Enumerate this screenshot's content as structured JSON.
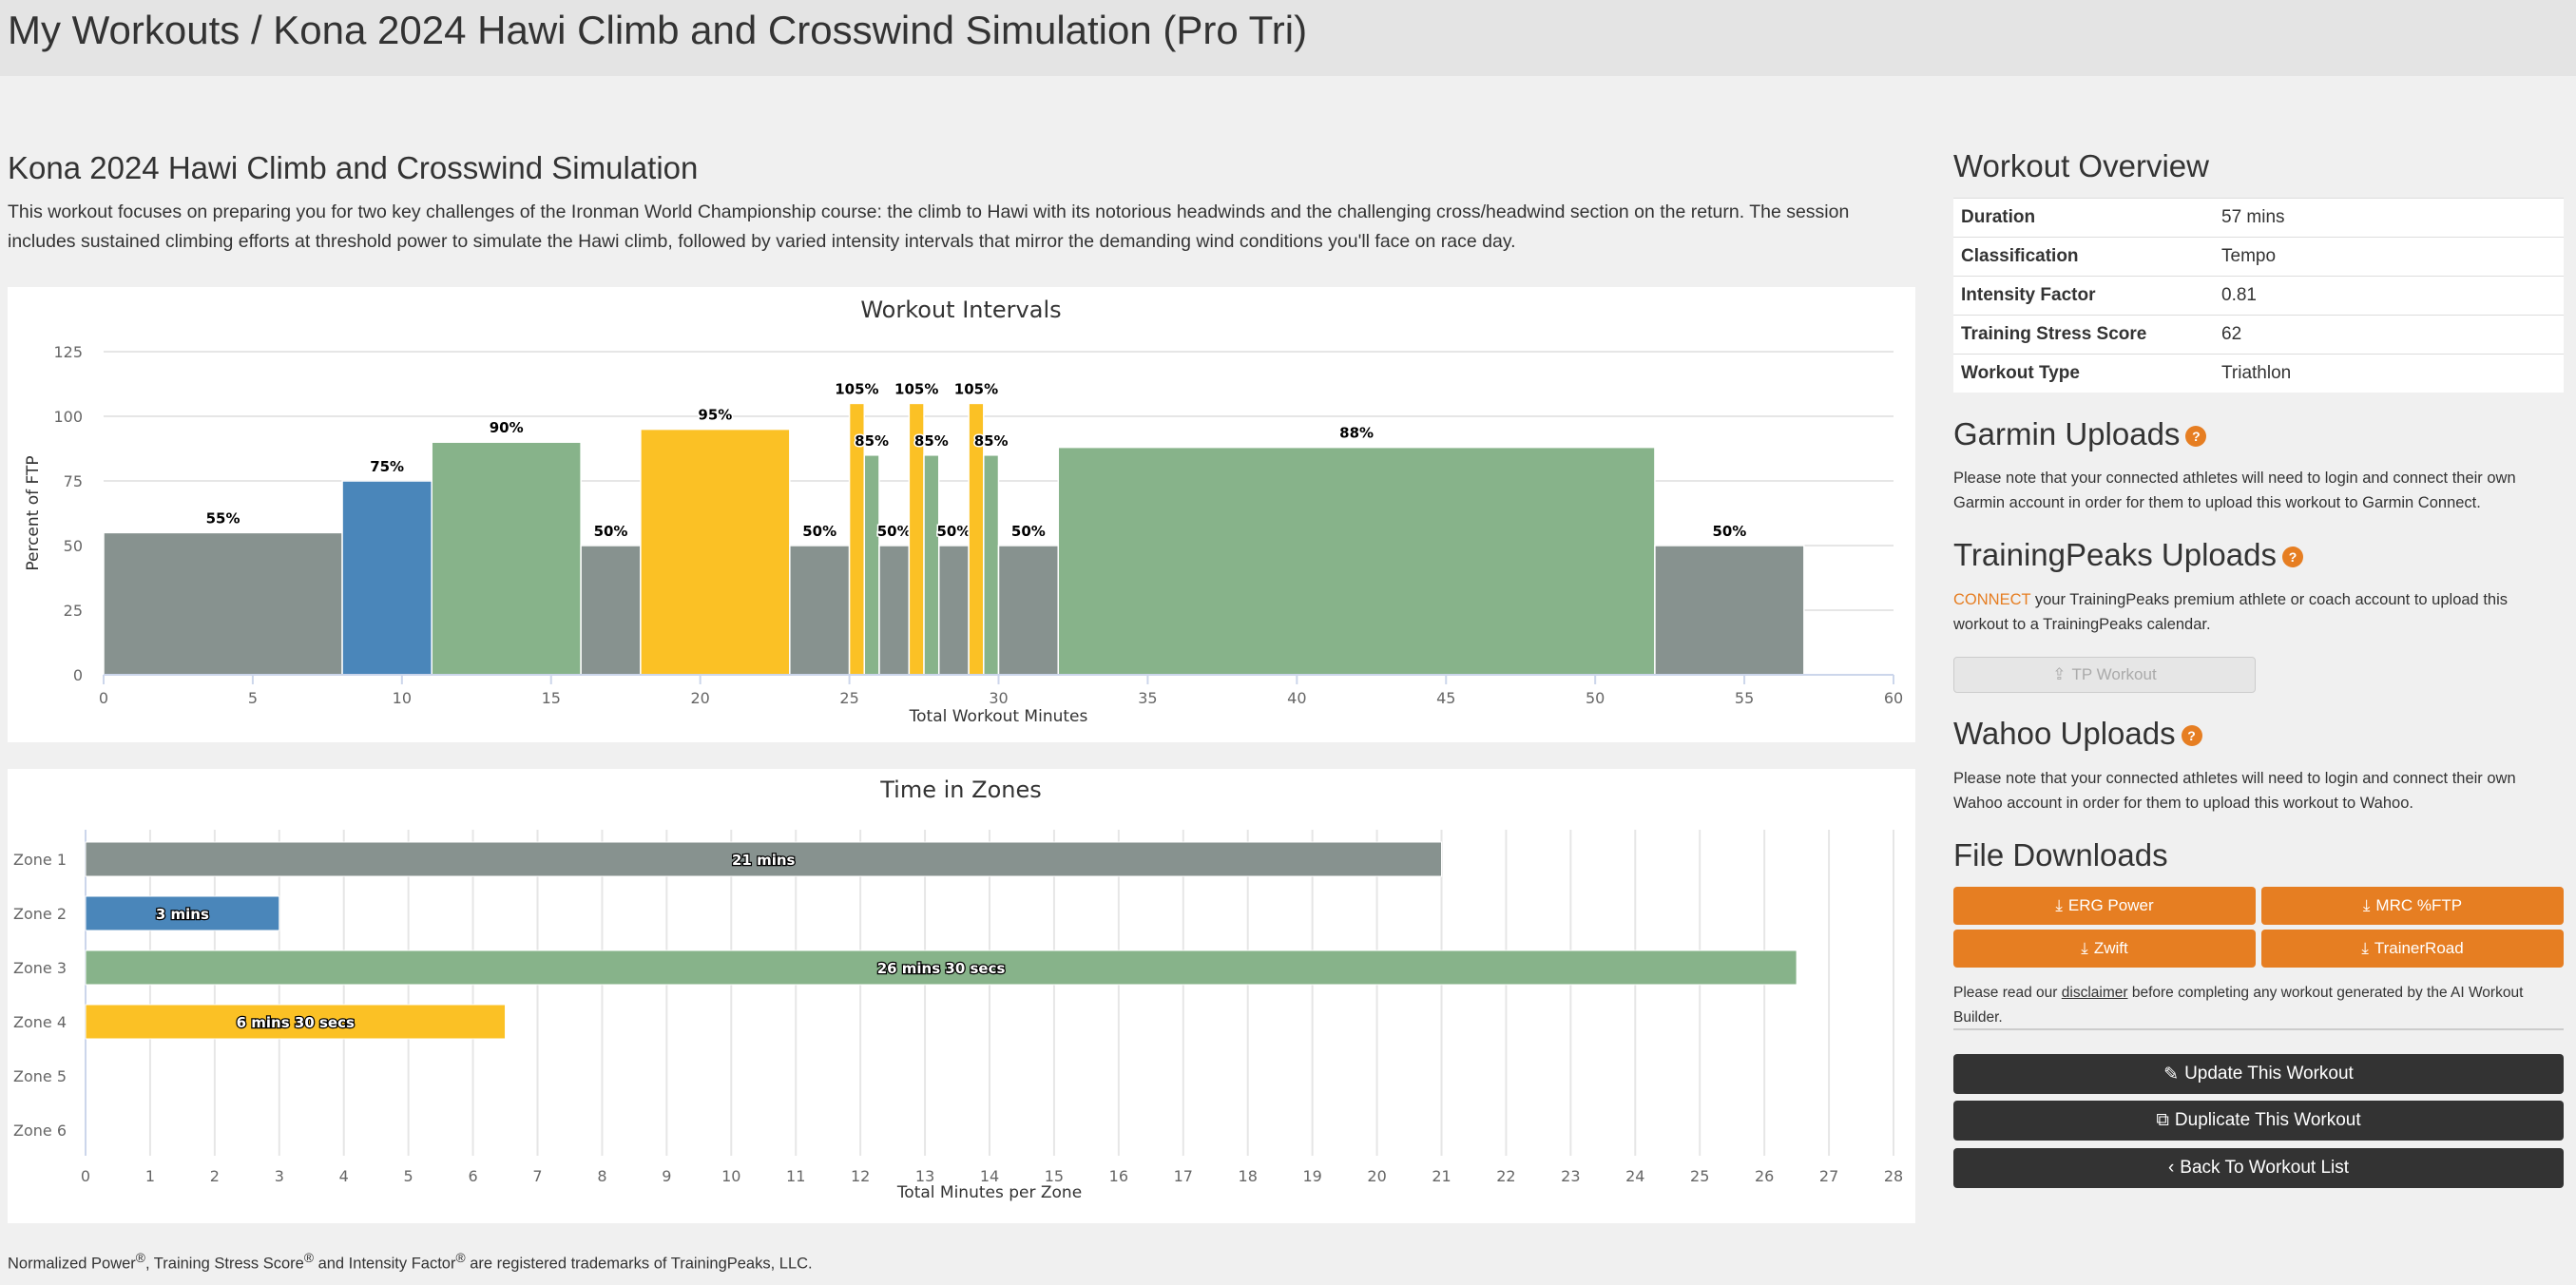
{
  "header": {
    "title": "My Workouts / Kona 2024 Hawi Climb and Crosswind Simulation (Pro Tri)"
  },
  "workout": {
    "title": "Kona 2024 Hawi Climb and Crosswind Simulation",
    "description": "This workout focuses on preparing you for two key challenges of the Ironman World Championship course: the climb to Hawi with its notorious headwinds and the challenging cross/headwind section on the return. The session includes sustained climbing efforts at threshold power to simulate the Hawi climb, followed by varied intensity intervals that mirror the demanding wind conditions you'll face on race day."
  },
  "colors": {
    "zone1": "#87928f",
    "zone2": "#4a86ba",
    "zone3": "#87b38a",
    "zone4": "#fbc125",
    "accent": "#e67e22",
    "dark": "#333333"
  },
  "chart_data": [
    {
      "type": "bar",
      "title": "Workout Intervals",
      "xlabel": "Total Workout Minutes",
      "ylabel": "Percent of FTP",
      "xlim": [
        0,
        60
      ],
      "ylim": [
        0,
        125
      ],
      "xticks": [
        0,
        5,
        10,
        15,
        20,
        25,
        30,
        35,
        40,
        45,
        50,
        55,
        60
      ],
      "yticks": [
        0,
        25,
        50,
        75,
        100,
        125
      ],
      "grid": true,
      "intervals": [
        {
          "start": 0,
          "end": 8,
          "value": 55,
          "label": "55%",
          "zone": 1
        },
        {
          "start": 8,
          "end": 11,
          "value": 75,
          "label": "75%",
          "zone": 2
        },
        {
          "start": 11,
          "end": 16,
          "value": 90,
          "label": "90%",
          "zone": 3
        },
        {
          "start": 16,
          "end": 18,
          "value": 50,
          "label": "50%",
          "zone": 1
        },
        {
          "start": 18,
          "end": 23,
          "value": 95,
          "label": "95%",
          "zone": 4
        },
        {
          "start": 23,
          "end": 25,
          "value": 50,
          "label": "50%",
          "zone": 1
        },
        {
          "start": 25,
          "end": 25.5,
          "value": 105,
          "label": "105%",
          "zone": 4
        },
        {
          "start": 25.5,
          "end": 26,
          "value": 85,
          "label": "85%",
          "zone": 3
        },
        {
          "start": 26,
          "end": 27,
          "value": 50,
          "label": "50%",
          "zone": 1
        },
        {
          "start": 27,
          "end": 27.5,
          "value": 105,
          "label": "105%",
          "zone": 4
        },
        {
          "start": 27.5,
          "end": 28,
          "value": 85,
          "label": "85%",
          "zone": 3
        },
        {
          "start": 28,
          "end": 29,
          "value": 50,
          "label": "50%",
          "zone": 1
        },
        {
          "start": 29,
          "end": 29.5,
          "value": 105,
          "label": "105%",
          "zone": 4
        },
        {
          "start": 29.5,
          "end": 30,
          "value": 85,
          "label": "85%",
          "zone": 3
        },
        {
          "start": 30,
          "end": 32,
          "value": 50,
          "label": "50%",
          "zone": 1
        },
        {
          "start": 32,
          "end": 52,
          "value": 88,
          "label": "88%",
          "zone": 3
        },
        {
          "start": 52,
          "end": 57,
          "value": 50,
          "label": "50%",
          "zone": 1
        }
      ]
    },
    {
      "type": "bar",
      "orientation": "horizontal",
      "title": "Time in Zones",
      "xlabel": "Total Minutes per Zone",
      "xlim": [
        0,
        28
      ],
      "xticks": [
        0,
        1,
        2,
        3,
        4,
        5,
        6,
        7,
        8,
        9,
        10,
        11,
        12,
        13,
        14,
        15,
        16,
        17,
        18,
        19,
        20,
        21,
        22,
        23,
        24,
        25,
        26,
        27,
        28
      ],
      "grid": true,
      "categories": [
        "Zone 1",
        "Zone 2",
        "Zone 3",
        "Zone 4",
        "Zone 5",
        "Zone 6"
      ],
      "values": [
        21,
        3,
        26.5,
        6.5,
        0,
        0
      ],
      "labels": [
        "21 mins",
        "3 mins",
        "26 mins 30 secs",
        "6 mins 30 secs",
        "",
        ""
      ]
    }
  ],
  "overview": {
    "title": "Workout Overview",
    "rows": [
      {
        "label": "Duration",
        "value": "57 mins"
      },
      {
        "label": "Classification",
        "value": "Tempo"
      },
      {
        "label": "Intensity Factor",
        "value": "0.81"
      },
      {
        "label": "Training Stress Score",
        "value": "62"
      },
      {
        "label": "Workout Type",
        "value": "Triathlon"
      }
    ]
  },
  "garmin": {
    "title": "Garmin Uploads",
    "text": "Please note that your connected athletes will need to login and connect their own Garmin account in order for them to upload this workout to Garmin Connect."
  },
  "trainingpeaks": {
    "title": "TrainingPeaks Uploads",
    "connect": "CONNECT",
    "text": " your TrainingPeaks premium athlete or coach account to upload this workout to a TrainingPeaks calendar.",
    "button": "TP Workout"
  },
  "wahoo": {
    "title": "Wahoo Uploads",
    "text": "Please note that your connected athletes will need to login and connect their own Wahoo account in order for them to upload this workout to Wahoo."
  },
  "downloads": {
    "title": "File Downloads",
    "buttons": [
      "ERG Power",
      "MRC %FTP",
      "Zwift",
      "TrainerRoad"
    ],
    "disclaimer_pre": "Please read our ",
    "disclaimer_link": "disclaimer",
    "disclaimer_post": " before completing any workout generated by the AI Workout Builder."
  },
  "actions": {
    "update": "Update This Workout",
    "duplicate": "Duplicate This Workout",
    "back": "Back To Workout List"
  },
  "footer": {
    "np": "Normalized Power",
    "reg": "®",
    "tss": ", Training Stress Score",
    "if": " and Intensity Factor",
    "rest": " are registered trademarks of TrainingPeaks, LLC."
  }
}
